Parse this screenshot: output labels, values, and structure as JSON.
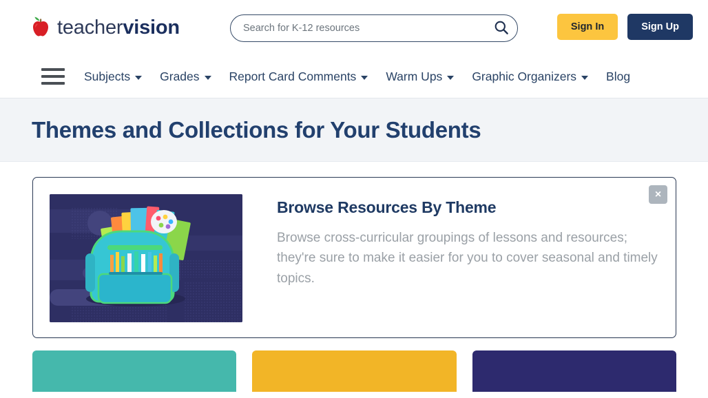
{
  "header": {
    "brand": {
      "light": "teacher",
      "bold": "vision",
      "logo_icon": "apple-icon"
    },
    "search": {
      "placeholder": "Search for K-12 resources",
      "value": "",
      "icon": "search-icon"
    },
    "sign_in_label": "Sign In",
    "sign_up_label": "Sign Up",
    "colors": {
      "sign_in_bg": "#fcc53f",
      "sign_in_text": "#20262e",
      "sign_up_bg": "#1f3864",
      "sign_up_text": "#ffffff",
      "brand_navy": "#1b2f5e"
    }
  },
  "nav": {
    "menu_icon": "hamburger-icon",
    "items": [
      {
        "label": "Subjects",
        "has_dropdown": true
      },
      {
        "label": "Grades",
        "has_dropdown": true
      },
      {
        "label": "Report Card Comments",
        "has_dropdown": true
      },
      {
        "label": "Warm Ups",
        "has_dropdown": true
      },
      {
        "label": "Graphic Organizers",
        "has_dropdown": true
      },
      {
        "label": "Blog",
        "has_dropdown": false
      }
    ]
  },
  "page": {
    "title": "Themes and Collections for Your Students",
    "title_band_bg": "#f2f4f7"
  },
  "feature_card": {
    "title": "Browse Resources By Theme",
    "description": "Browse cross-curricular groupings of lessons and resources; they're sure to make it easier for you to cover seasonal and timely topics.",
    "close_label": "×",
    "close_icon": "close-icon",
    "image_alt": "backpack-illustration"
  },
  "tiles": [
    {
      "name": "tile-teal",
      "color": "#45b8ac"
    },
    {
      "name": "tile-yellow",
      "color": "#f2b527"
    },
    {
      "name": "tile-purple",
      "color": "#2d2a6e"
    }
  ]
}
